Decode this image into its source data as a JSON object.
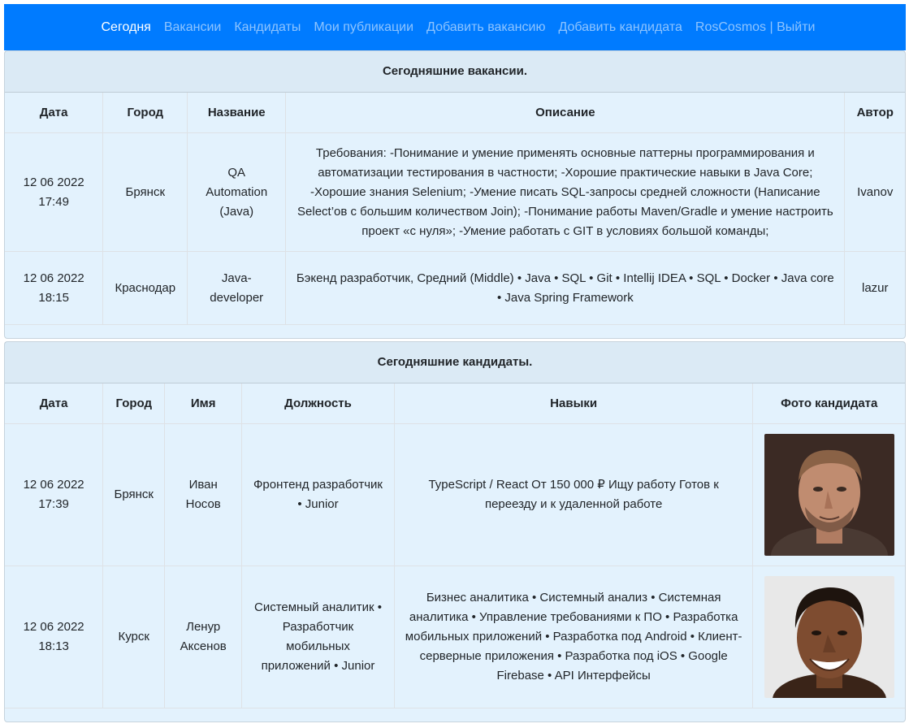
{
  "nav": {
    "items": [
      "Сегодня",
      "Вакансии",
      "Кандидаты",
      "Мои публикации",
      "Добавить вакансию",
      "Добавить кандидата"
    ],
    "user": "RosCosmos",
    "separator": "|",
    "logout": "Выйти"
  },
  "vacancies": {
    "title": "Сегодняшние вакансии.",
    "headers": [
      "Дата",
      "Город",
      "Название",
      "Описание",
      "Автор"
    ],
    "rows": [
      {
        "date": "12 06 2022",
        "time": "17:49",
        "city": "Брянск",
        "name": "QA Automation (Java)",
        "description": "Требования: -Понимание и умение применять основные паттерны программирования и автоматизации тестирования в частности; -Хорошие практические навыки в Java Core; -Хорошие знания Selenium; -Умение писать SQL-запросы средней сложности (Написание Select’ов с большим количеством Join); -Понимание работы Maven/Gradle и умение настроить проект «с нуля»; -Умение работать с GIT в условиях большой команды;",
        "author": "Ivanov"
      },
      {
        "date": "12 06 2022",
        "time": "18:15",
        "city": "Краснодар",
        "name": "Java-developer",
        "description": "Бэкенд разработчик, Средний (Middle) • Java • SQL • Git • Intellij IDEA • SQL • Docker • Java core • Java Spring Framework",
        "author": "lazur"
      }
    ]
  },
  "candidates": {
    "title": "Сегодняшние кандидаты.",
    "headers": [
      "Дата",
      "Город",
      "Имя",
      "Должность",
      "Навыки",
      "Фото кандидата"
    ],
    "rows": [
      {
        "date": "12 06 2022",
        "time": "17:39",
        "city": "Брянск",
        "first_name": "Иван",
        "last_name": "Носов",
        "position": "Фронтенд разработчик • Junior",
        "skills": "TypeScript / React От 150 000 ₽ Ищу работу Готов к переезду и к удаленной работе",
        "photo": "candidate-photo-1"
      },
      {
        "date": "12 06 2022",
        "time": "18:13",
        "city": "Курск",
        "first_name": "Ленур",
        "last_name": "Аксенов",
        "position": "Системный аналитик • Разработчик мобильных приложений • Junior",
        "skills": "Бизнес аналитика • Системный анализ • Системная аналитика • Управление требованиями к ПО • Разработка мобильных приложений • Разработка под Android • Клиент-серверные приложения • Разработка под iOS • Google Firebase • API Интерфейсы",
        "photo": "candidate-photo-2"
      }
    ]
  },
  "colors": {
    "navbar": "#007bff",
    "card_background": "#e3f2fd"
  }
}
